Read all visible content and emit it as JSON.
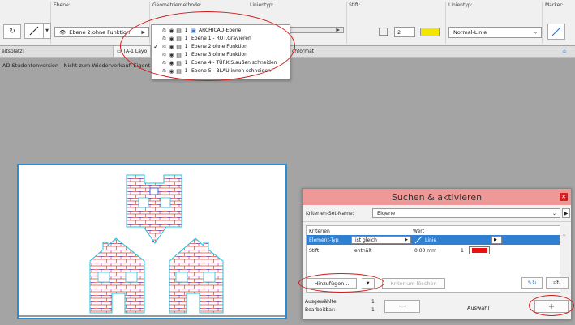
{
  "infobox": {
    "layer_group_label": "Ebene:",
    "layer_value": "Ebene 2.ohne Funktion",
    "geometry_label": "Geometriemethode:",
    "linetype_label": "Linientyp:",
    "pen_label": "Stift:",
    "pen_value": "2",
    "linetype2_label": "Linientyp:",
    "linetype2_value": "Normal-Linie",
    "marker_label": "Marker:"
  },
  "tabs": {
    "workspace_tab": "eitsplatz]",
    "layout_tab": "[A-1 Layo",
    "format_tab": "chformat]"
  },
  "layer_popup": {
    "rows": [
      {
        "check": "",
        "num": "1",
        "name": "ARCHICAD-Ebene"
      },
      {
        "check": "",
        "num": "1",
        "name": "Ebene 1 - ROT.Gravieren"
      },
      {
        "check": "✓",
        "num": "1",
        "name": "Ebene 2.ohne Funktion"
      },
      {
        "check": "",
        "num": "1",
        "name": "Ebene 3.ohne Funktion"
      },
      {
        "check": "",
        "num": "1",
        "name": "Ebene 4 - TÜRKIS.außen schneiden"
      },
      {
        "check": "",
        "num": "1",
        "name": "Ebene 5 - BLAU.innen schneiden"
      }
    ]
  },
  "watermark": "AD Studentenversion - Nicht zum Wiederverkauf. Eigent",
  "find_select": {
    "title": "Suchen & aktivieren",
    "set_name_label": "Kriterien-Set-Name:",
    "set_name_value": "Eigene",
    "col_criteria": "Kriterien",
    "col_value": "Wert",
    "rows": [
      {
        "criterion": "Element-Typ",
        "operator": "ist gleich",
        "value": "Linie"
      },
      {
        "criterion": "Stift",
        "operator": "enthält",
        "value": "0.00 mm",
        "pen_num": "1"
      }
    ],
    "add_button": "Hinzufügen...",
    "remove_button": "Kriterium löschen",
    "selected_label": "Ausgewählte:",
    "selected_count": "1",
    "editable_label": "Bearbeitbar:",
    "editable_count": "1",
    "minus_button": "—",
    "selection_label": "Auswahl",
    "plus_button": "+"
  },
  "colors": {
    "accent": "#2f7fd2",
    "title_bar": "#ee9898",
    "annotation": "#d11a1a",
    "brick_red": "#e0302a",
    "brick_blue": "#2b3fd8",
    "outline_cyan": "#19c7e0",
    "pen_swatch_yellow": "#f2e600",
    "pen_swatch_red": "#e81010"
  }
}
